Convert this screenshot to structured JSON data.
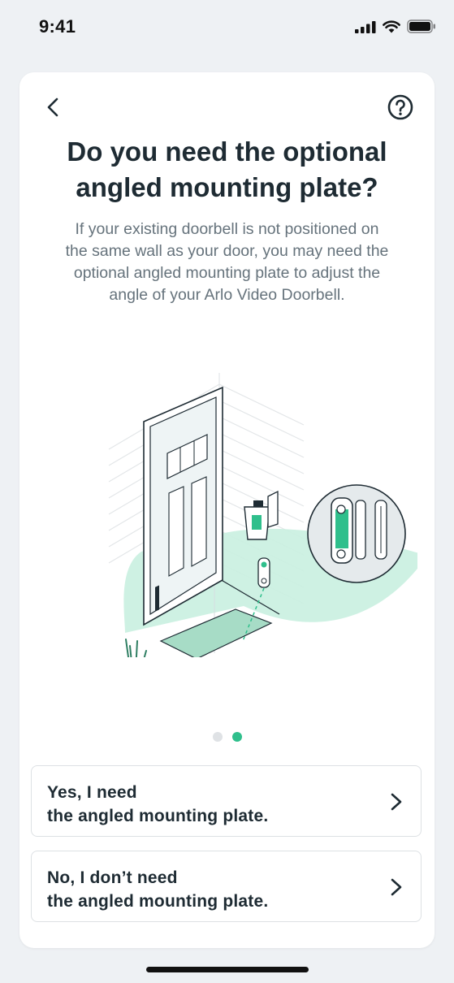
{
  "status_bar": {
    "time": "9:41",
    "icons": [
      "cellular-signal-icon",
      "wifi-icon",
      "battery-icon"
    ]
  },
  "header": {
    "back_icon": "chevron-left-icon",
    "help_icon": "question-circle-icon"
  },
  "title": "Do you need the optional\nangled mounting plate?",
  "subtitle": "If your existing doorbell is not positioned on\nthe same wall as your door, you may need the\noptional angled mounting plate to adjust the\nangle of your Arlo Video Doorbell.",
  "pager": {
    "total": 2,
    "active_index": 1
  },
  "options": [
    {
      "label": "Yes, I need\nthe angled mounting plate.",
      "icon": "chevron-right-icon"
    },
    {
      "label": "No, I don’t need\nthe angled mounting plate.",
      "icon": "chevron-right-icon"
    }
  ],
  "colors": {
    "accent": "#2fbf8c",
    "accent_light": "#c9f0e0",
    "text_primary": "#1e2b33",
    "text_secondary": "#66737c",
    "background": "#eef1f4"
  }
}
